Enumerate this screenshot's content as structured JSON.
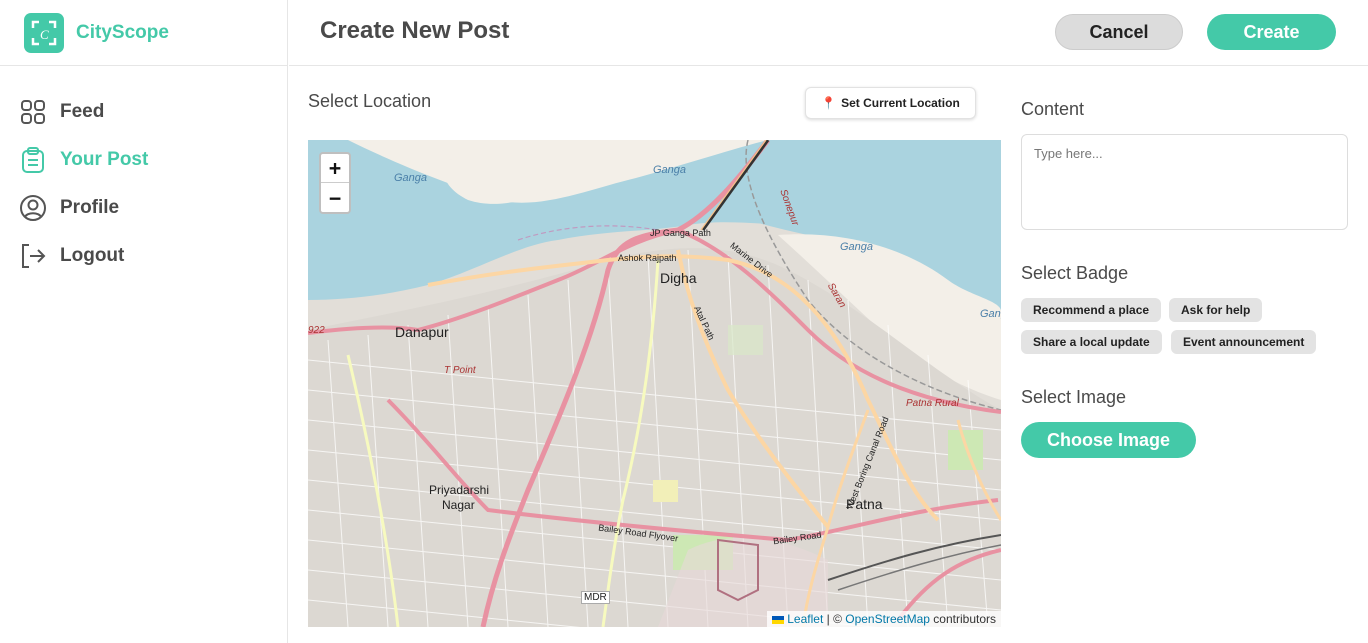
{
  "brand": {
    "name": "CityScope",
    "logo_letter": "C"
  },
  "sidebar": {
    "items": [
      {
        "label": "Feed",
        "icon": "grid-icon",
        "active": false
      },
      {
        "label": "Your Post",
        "icon": "clipboard-icon",
        "active": true
      },
      {
        "label": "Profile",
        "icon": "user-circle-icon",
        "active": false
      },
      {
        "label": "Logout",
        "icon": "logout-icon",
        "active": false
      }
    ]
  },
  "header": {
    "title": "Create New Post",
    "cancel_label": "Cancel",
    "create_label": "Create"
  },
  "location": {
    "label": "Select Location",
    "set_current_label": "Set Current Location",
    "map": {
      "zoom_in": "+",
      "zoom_out": "−",
      "attribution_leaflet": "Leaflet",
      "attribution_sep": " | © ",
      "attribution_osm": "OpenStreetMap",
      "attribution_suffix": " contributors",
      "places": {
        "danapur": "Danapur",
        "digha": "Digha",
        "patna": "Patna",
        "priyadarshi": "Priyadarshi",
        "nagar": "Nagar",
        "mdr": "MDR",
        "ganga1": "Ganga",
        "ganga2": "Ganga",
        "ganga3": "Ganga",
        "ganga4": "Ganga",
        "ashok": "Ashok Rajpath",
        "jp_ganga": "JP Ganga Path",
        "marine": "Marine Drive",
        "bailey": "Bailey Road Flyover",
        "bailey2": "Bailey Road",
        "atal": "Atal Path",
        "wbcr": "West Boring Canal Road",
        "tpoint": "T Point",
        "sonepur": "Sonepur",
        "saran": "Saran",
        "n922": "922",
        "patna_rural": "Patna Rural"
      }
    }
  },
  "content": {
    "label": "Content",
    "placeholder": "Type here..."
  },
  "badges": {
    "label": "Select Badge",
    "items": [
      "Recommend a place",
      "Ask for help",
      "Share a local update",
      "Event announcement"
    ]
  },
  "image": {
    "label": "Select Image",
    "button_label": "Choose Image"
  },
  "colors": {
    "accent": "#44c9a8",
    "water": "#aad3df",
    "major_road": "#e892a2",
    "secondary_road": "#fcd6a4"
  }
}
